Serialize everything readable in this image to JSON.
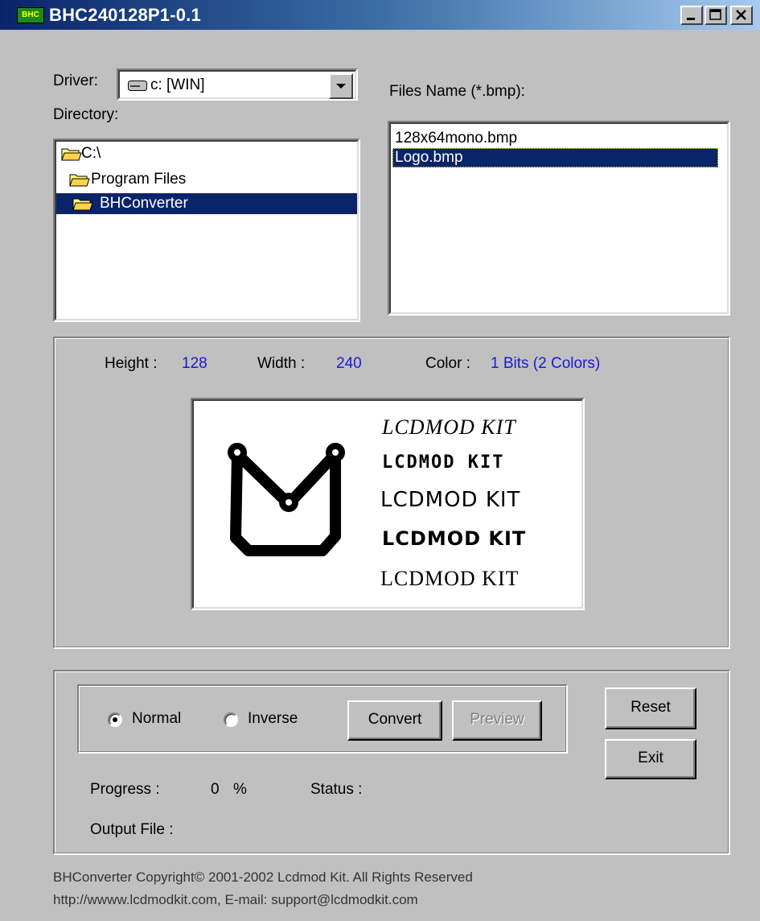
{
  "window": {
    "title": "BHC240128P1-0.1",
    "icon_label": "BHC",
    "controls": [
      "minimize",
      "maximize",
      "close"
    ]
  },
  "driver": {
    "label": "Driver:",
    "value": "c: [WIN]"
  },
  "directory": {
    "label": "Directory:",
    "items": [
      {
        "label": "C:\\",
        "icon": "open-folder-icon",
        "selected": false
      },
      {
        "label": "Program Files",
        "icon": "open-folder-icon",
        "selected": false
      },
      {
        "label": "BHConverter",
        "icon": "open-folder-icon",
        "selected": true
      }
    ]
  },
  "files": {
    "label": "Files Name (*.bmp):",
    "items": [
      {
        "label": "128x64mono.bmp",
        "selected": false
      },
      {
        "label": "Logo.bmp",
        "selected": true
      }
    ]
  },
  "image_info": {
    "height_label": "Height :",
    "height_value": "128",
    "width_label": "Width :",
    "width_value": "240",
    "color_label": "Color :",
    "color_value": "1 Bits  (2 Colors)"
  },
  "preview": {
    "logo_name": "lcdmod-logo",
    "lines": [
      "LCDMOD KIT",
      "LCDMOD  KIT",
      "LCDMOD  KIT",
      "LCDMOD KIT",
      "LCDMOD KIT"
    ]
  },
  "options": {
    "normal_label": "Normal",
    "normal_checked": true,
    "inverse_label": "Inverse",
    "inverse_checked": false,
    "convert_label": "Convert",
    "preview_label": "Preview",
    "preview_enabled": false,
    "reset_label": "Reset",
    "exit_label": "Exit"
  },
  "status": {
    "progress_label": "Progress :",
    "progress_value": "0",
    "progress_unit": "%",
    "status_label": "Status :",
    "status_value": "",
    "output_label": "Output File :",
    "output_value": ""
  },
  "footer": {
    "copyright": "BHConverter Copyright©  2001-2002 Lcdmod Kit. All Rights Reserved",
    "contact": "http://wwww.lcdmodkit.com, E-mail: support@lcdmodkit.com"
  },
  "colors": {
    "selection": "#0a246a",
    "value_blue": "#1a1ad6",
    "face": "#c0c0c0"
  }
}
